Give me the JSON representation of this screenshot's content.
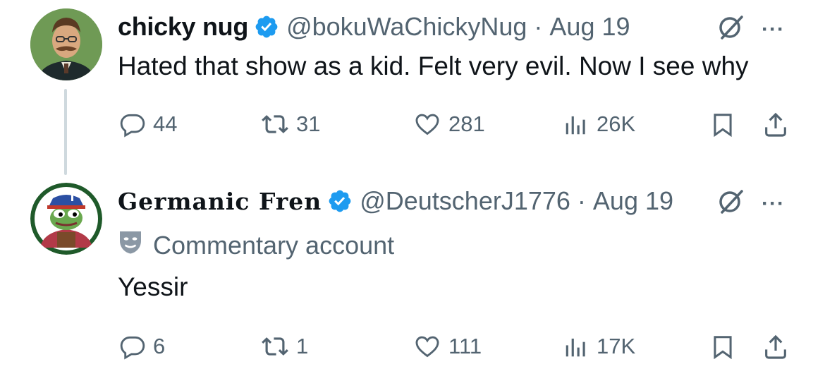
{
  "tweets": [
    {
      "name": "chicky nug",
      "handle": "@bokuWaChickyNug",
      "separator": "·",
      "date": "Aug 19",
      "text": "Hated that show as a kid. Felt very evil. Now I see why",
      "stats": {
        "replies": "44",
        "reposts": "31",
        "likes": "281",
        "views": "26K"
      },
      "more": "···"
    },
    {
      "name": "Germanic Fren",
      "handle": "@DeutscherJ1776",
      "separator": "·",
      "date": "Aug 19",
      "label": "Commentary account",
      "text": "Yessir",
      "stats": {
        "replies": "6",
        "reposts": "1",
        "likes": "111",
        "views": "17K"
      },
      "more": "···"
    }
  ],
  "colors": {
    "text": "#0f1419",
    "secondary": "#536471",
    "verified": "#1d9bf0",
    "thread_line": "#cfd9de"
  },
  "icons": [
    "verified-badge-icon",
    "grok-icon",
    "more-icon",
    "reply-icon",
    "repost-icon",
    "like-icon",
    "views-icon",
    "bookmark-icon",
    "share-icon",
    "commentary-mask-icon"
  ]
}
